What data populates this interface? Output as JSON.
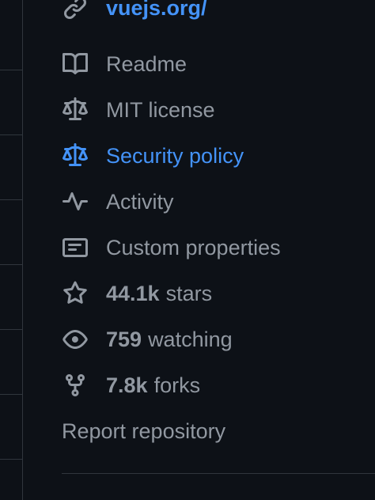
{
  "about": {
    "website": {
      "label": "vuejs.org/",
      "icon": "link-icon",
      "color": "#4493f8"
    },
    "items": [
      {
        "label": "Readme",
        "icon": "book-icon"
      },
      {
        "label": "MIT license",
        "icon": "law-icon"
      },
      {
        "label": "Security policy",
        "icon": "law-icon",
        "color": "#4493f8"
      },
      {
        "label": "Activity",
        "icon": "pulse-icon"
      },
      {
        "label": "Custom properties",
        "icon": "note-icon"
      }
    ],
    "stats": {
      "stars": {
        "count": "44.1k",
        "label": "stars",
        "icon": "star-icon"
      },
      "watching": {
        "count": "759",
        "label": "watching",
        "icon": "eye-icon"
      },
      "forks": {
        "count": "7.8k",
        "label": "forks",
        "icon": "fork-icon"
      }
    },
    "report": "Report repository"
  },
  "colors": {
    "background": "#0d1117",
    "muted_text": "#9198a1",
    "accent": "#4493f8",
    "border": "#30363d"
  }
}
